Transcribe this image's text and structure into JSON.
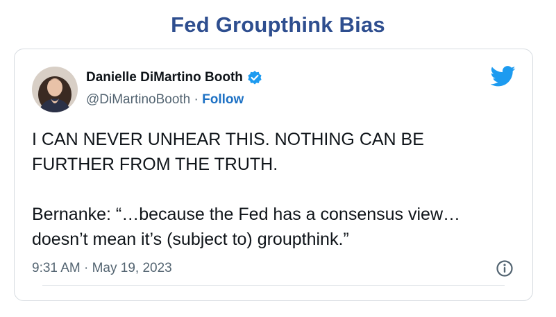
{
  "page": {
    "title": "Fed Groupthink Bias"
  },
  "tweet": {
    "author_name": "Danielle DiMartino Booth",
    "handle": "@DiMartinoBooth",
    "separator": " · ",
    "follow_label": "Follow",
    "text_lines": [
      "I CAN NEVER UNHEAR THIS. NOTHING CAN BE",
      "FURTHER FROM THE TRUTH.",
      "Bernanke: “…because the Fed has a consensus view…",
      "doesn’t mean it’s (subject to) groupthink.”"
    ],
    "timestamp": "9:31 AM · May 19, 2023"
  },
  "colors": {
    "title": "#2e4e8f",
    "twitter_blue": "#1d9bf0",
    "follow": "#1d71c4",
    "muted": "#536471"
  },
  "icons": {
    "brand": "twitter-bird-icon",
    "verified": "verified-badge-icon",
    "info": "info-icon"
  }
}
